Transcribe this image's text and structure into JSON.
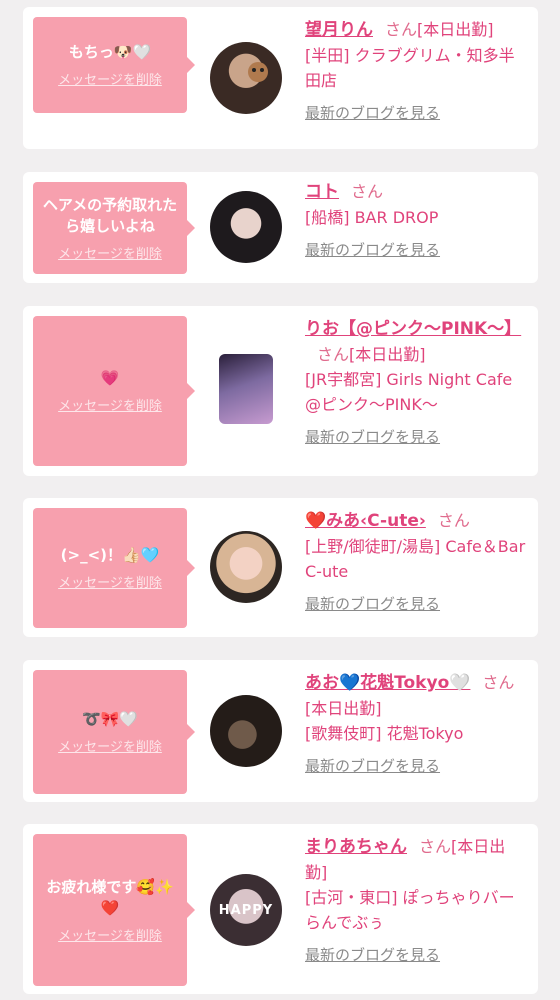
{
  "delete_label": "メッセージを削除",
  "blog_label": "最新のブログを見る",
  "san_label": "さん",
  "entries": [
    {
      "message": "もちっ🐶🤍",
      "name": "望月りん",
      "status": "[本日出勤]",
      "shop": "[半田] クラブグリム・知多半田店"
    },
    {
      "message": "ヘアメの予約取れたら嬉しいよね",
      "name": "コト",
      "status": "",
      "shop": "[船橋] BAR DROP"
    },
    {
      "message": "💗",
      "name": "りお【@ピンク〜PINK〜】",
      "status": "[本日出勤]",
      "shop": "[JR宇都宮] Girls Night Cafe @ピンク〜PINK〜"
    },
    {
      "message": "(>_<)！👍🏻🩵",
      "name": "❤️みあ‹C-ute›",
      "status": "",
      "shop": "[上野/御徒町/湯島] Cafe＆Bar C-ute"
    },
    {
      "message": "➰🎀🤍",
      "name": "あお💙花魁Tokyo🤍",
      "status": "[本日出勤]",
      "shop": "[歌舞伎町] 花魁Tokyo"
    },
    {
      "message": "お疲れ様です🥰✨❤️",
      "name": "まりあちゃん",
      "status": "[本日出勤]",
      "shop": "[古河・東口] ぽっちゃりバー らんでぶぅ"
    }
  ],
  "avatar_label_6": "HAPPY"
}
